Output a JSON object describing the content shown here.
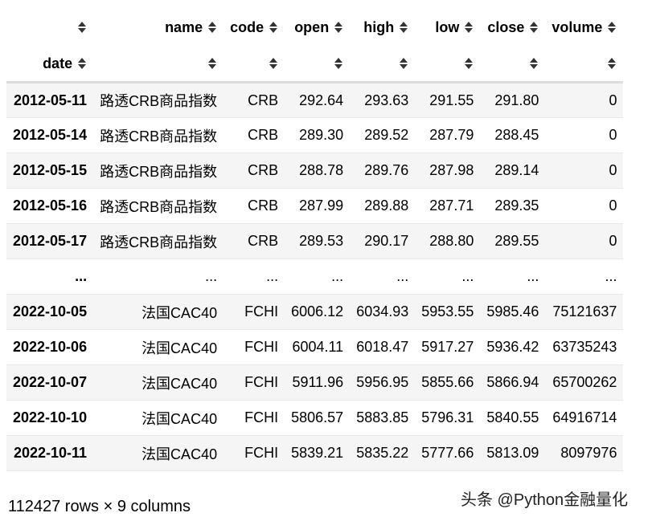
{
  "table": {
    "columns": [
      "name",
      "code",
      "open",
      "high",
      "low",
      "close",
      "volume"
    ],
    "index_name": "date",
    "rows": [
      {
        "date": "2012-05-11",
        "name": "路透CRB商品指数",
        "code": "CRB",
        "open": "292.64",
        "high": "293.63",
        "low": "291.55",
        "close": "291.80",
        "volume": "0"
      },
      {
        "date": "2012-05-14",
        "name": "路透CRB商品指数",
        "code": "CRB",
        "open": "289.30",
        "high": "289.52",
        "low": "287.79",
        "close": "288.45",
        "volume": "0"
      },
      {
        "date": "2012-05-15",
        "name": "路透CRB商品指数",
        "code": "CRB",
        "open": "288.78",
        "high": "289.76",
        "low": "287.98",
        "close": "289.14",
        "volume": "0"
      },
      {
        "date": "2012-05-16",
        "name": "路透CRB商品指数",
        "code": "CRB",
        "open": "287.99",
        "high": "289.88",
        "low": "287.71",
        "close": "289.35",
        "volume": "0"
      },
      {
        "date": "2012-05-17",
        "name": "路透CRB商品指数",
        "code": "CRB",
        "open": "289.53",
        "high": "290.17",
        "low": "288.80",
        "close": "289.55",
        "volume": "0"
      },
      {
        "date": "...",
        "name": "...",
        "code": "...",
        "open": "...",
        "high": "...",
        "low": "...",
        "close": "...",
        "volume": "..."
      },
      {
        "date": "2022-10-05",
        "name": "法国CAC40",
        "code": "FCHI",
        "open": "6006.12",
        "high": "6034.93",
        "low": "5953.55",
        "close": "5985.46",
        "volume": "75121637"
      },
      {
        "date": "2022-10-06",
        "name": "法国CAC40",
        "code": "FCHI",
        "open": "6004.11",
        "high": "6018.47",
        "low": "5917.27",
        "close": "5936.42",
        "volume": "63735243"
      },
      {
        "date": "2022-10-07",
        "name": "法国CAC40",
        "code": "FCHI",
        "open": "5911.96",
        "high": "5956.95",
        "low": "5855.66",
        "close": "5866.94",
        "volume": "65700262"
      },
      {
        "date": "2022-10-10",
        "name": "法国CAC40",
        "code": "FCHI",
        "open": "5806.57",
        "high": "5883.85",
        "low": "5796.31",
        "close": "5840.55",
        "volume": "64916714"
      },
      {
        "date": "2022-10-11",
        "name": "法国CAC40",
        "code": "FCHI",
        "open": "5839.21",
        "high": "5835.22",
        "low": "5777.66",
        "close": "5813.09",
        "volume": "8097976"
      }
    ]
  },
  "footer": "112427 rows × 9 columns",
  "watermark": "头条 @Python金融量化",
  "icons": {
    "sort": "sort-updown-icon"
  }
}
